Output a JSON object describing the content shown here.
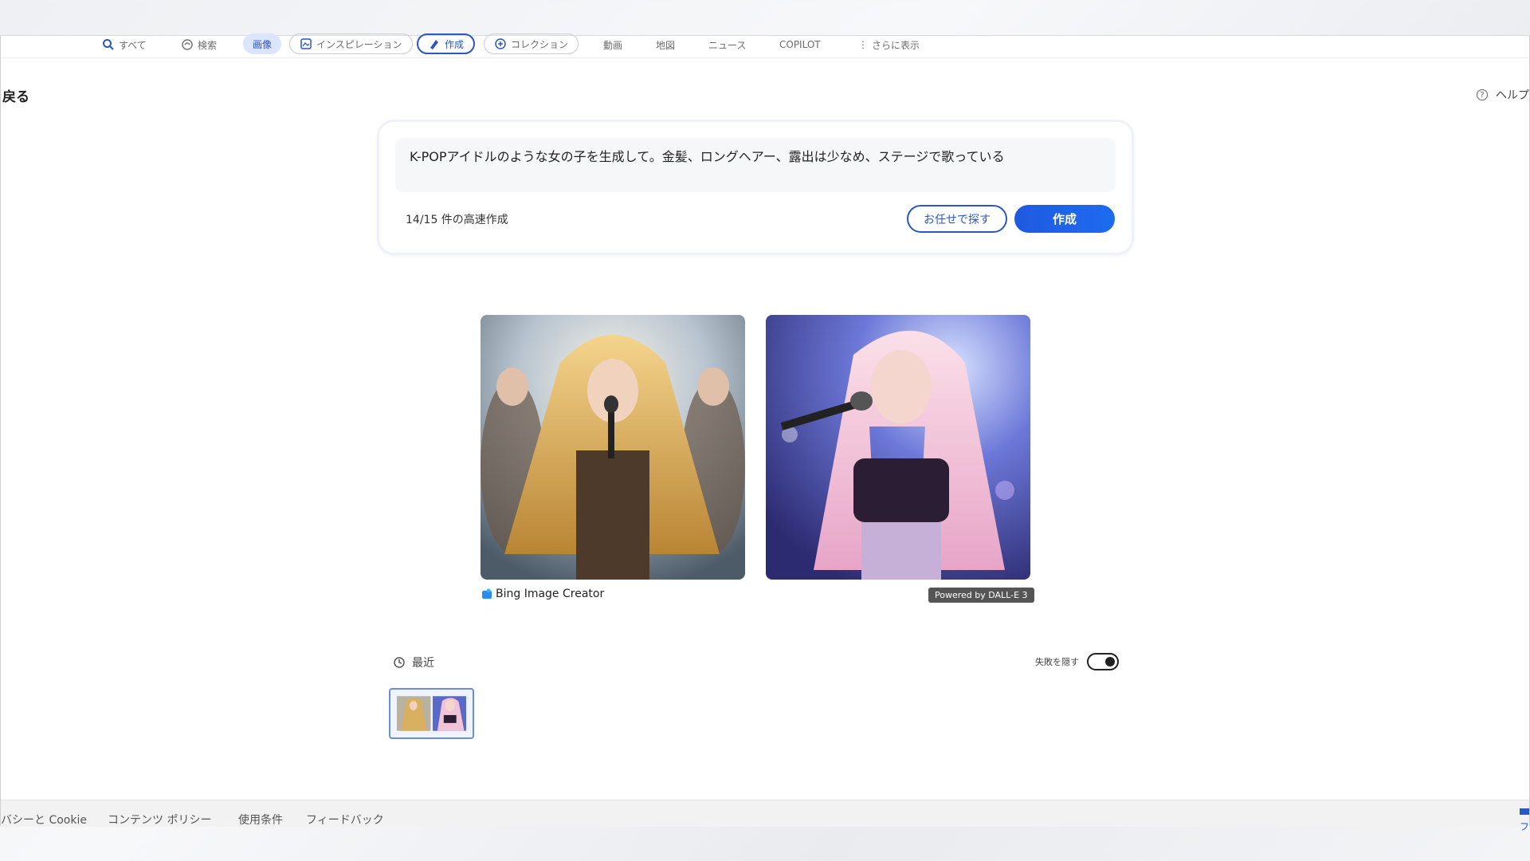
{
  "nav": {
    "items": [
      {
        "label": "すべて",
        "icon": "search-icon"
      },
      {
        "label": "検索",
        "icon": "copilot-icon"
      },
      {
        "label": "画像"
      },
      {
        "label": "インスピレーション",
        "icon": "inspiration-icon"
      },
      {
        "label": "作成",
        "icon": "create-icon"
      },
      {
        "label": "コレクション",
        "icon": "collection-icon"
      },
      {
        "label": "動画"
      },
      {
        "label": "地図"
      },
      {
        "label": "ニュース"
      },
      {
        "label": "COPILOT"
      },
      {
        "label": "さらに表示",
        "icon": "more-vertical-icon"
      }
    ]
  },
  "header": {
    "back_label": "戻る",
    "help_label": "ヘルプ",
    "help_icon": "help-icon"
  },
  "prompt": {
    "text": "K-POPアイドルのような女の子を生成して。金髪、ロングヘアー、露出は少なめ、ステージで歌っている",
    "quota": "14/15 件の高速作成",
    "surprise_label": "お任せで探す",
    "create_label": "作成"
  },
  "results": {
    "creator_label": "Bing Image Creator",
    "creator_icon": "bing-image-creator-icon",
    "powered_label": "Powered by DALL-E 3"
  },
  "recent": {
    "label": "最近",
    "icon": "history-icon",
    "hide_failures_label": "失敗を隠す",
    "hide_failures_on": true
  },
  "footer": {
    "links": [
      "バシーと Cookie",
      "コンテンツ ポリシー",
      "使用条件",
      "フィードバック"
    ],
    "right_label": "フィードバ"
  },
  "colors": {
    "accent": "#2a56c6",
    "create_button": "#1f5ae0",
    "page_bg": "#ffffff"
  }
}
